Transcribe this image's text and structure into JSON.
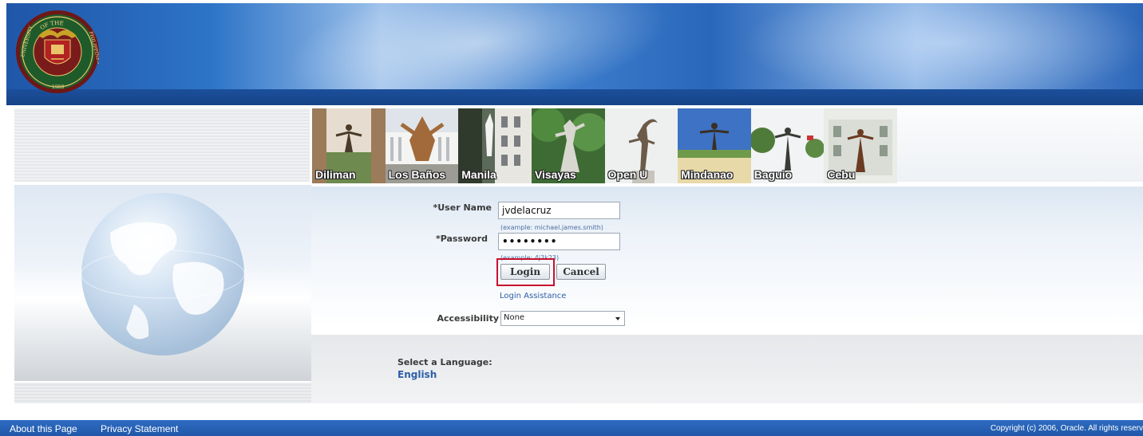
{
  "header": {
    "seal_text": [
      "OF THE",
      "UNIVERSITY",
      "PHILIPPINES",
      "1908"
    ]
  },
  "campuses": [
    {
      "label": "Diliman"
    },
    {
      "label": "Los Baños"
    },
    {
      "label": "Manila"
    },
    {
      "label": "Visayas"
    },
    {
      "label": "Open U"
    },
    {
      "label": "Mindanao"
    },
    {
      "label": "Baguio"
    },
    {
      "label": "Cebu"
    }
  ],
  "login": {
    "username_label": "*User Name",
    "username_value": "jvdelacruz",
    "username_hint": "(example: michael.james.smith)",
    "password_label": "*Password",
    "password_value": "••••••••",
    "password_hint": "(example: 4j3k23)",
    "login_button": "Login",
    "cancel_button": "Cancel",
    "assistance_link": "Login Assistance",
    "accessibility_label": "Accessibility",
    "accessibility_value": "None"
  },
  "language": {
    "label": "Select a Language:",
    "value": "English"
  },
  "footer": {
    "about": "About this Page",
    "privacy": "Privacy Statement",
    "copyright": "Copyright (c) 2006, Oracle. All rights reserv"
  },
  "colors": {
    "footer_blue": "#1f58a8",
    "link_blue": "#2d5ea8",
    "highlight_red": "#c8102e",
    "seal_maroon": "#7a1b1b",
    "seal_green": "#1f5b2a"
  }
}
